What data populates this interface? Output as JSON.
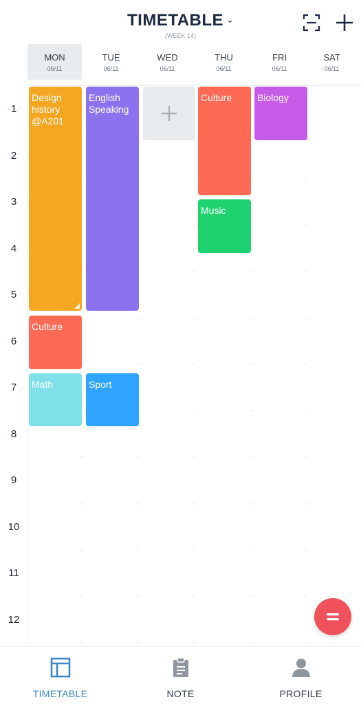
{
  "header": {
    "title": "TIMETABLE",
    "week": "(WEEK 14)",
    "dropdown_icon": "chevron-down-icon",
    "scan_icon": "scan-icon",
    "add_icon": "plus-icon"
  },
  "days": [
    {
      "name": "MON",
      "date": "06/11",
      "active": true
    },
    {
      "name": "TUE",
      "date": "06/11",
      "active": false
    },
    {
      "name": "WED",
      "date": "06/11",
      "active": false
    },
    {
      "name": "THU",
      "date": "06/11",
      "active": false
    },
    {
      "name": "FRI",
      "date": "06/11",
      "active": false
    },
    {
      "name": "SAT",
      "date": "06/11",
      "active": false
    }
  ],
  "hours": [
    "1",
    "2",
    "3",
    "4",
    "5",
    "6",
    "7",
    "8",
    "9",
    "10",
    "11",
    "12"
  ],
  "events": [
    {
      "label": "Design\nhistory\n@A201",
      "day": "MON",
      "start": 1,
      "end": 5,
      "color": "#f5a623"
    },
    {
      "label": "English\nSpeaking",
      "day": "TUE",
      "start": 1,
      "end": 5,
      "color": "#8b73f0"
    },
    {
      "label": "Culture",
      "day": "THU",
      "start": 1,
      "end": 3,
      "color": "#ff6a55"
    },
    {
      "label": "Biology",
      "day": "FRI",
      "start": 1,
      "end": 1,
      "color": "#c65be8"
    },
    {
      "label": "Music",
      "day": "THU",
      "start": 3,
      "end": 4,
      "color": "#1ed26f"
    },
    {
      "label": "Culture",
      "day": "MON",
      "start": 6,
      "end": 6,
      "color": "#ff6a55"
    },
    {
      "label": "Math",
      "day": "MON",
      "start": 7,
      "end": 7,
      "color": "#7fe0ea"
    },
    {
      "label": "Sport",
      "day": "TUE",
      "start": 7,
      "end": 7,
      "color": "#2ea4ff"
    }
  ],
  "add_slot": {
    "day": "WED",
    "icon": "plus-icon"
  },
  "fab": {
    "icon": "menu-icon",
    "color": "#f0525c"
  },
  "bottom_nav": [
    {
      "label": "TIMETABLE",
      "icon": "timetable-icon",
      "active": true
    },
    {
      "label": "NOTE",
      "icon": "clipboard-icon",
      "active": false
    },
    {
      "label": "PROFILE",
      "icon": "person-icon",
      "active": false
    }
  ],
  "colors": {
    "accent": "#3d87c7",
    "title": "#1d2a44"
  }
}
